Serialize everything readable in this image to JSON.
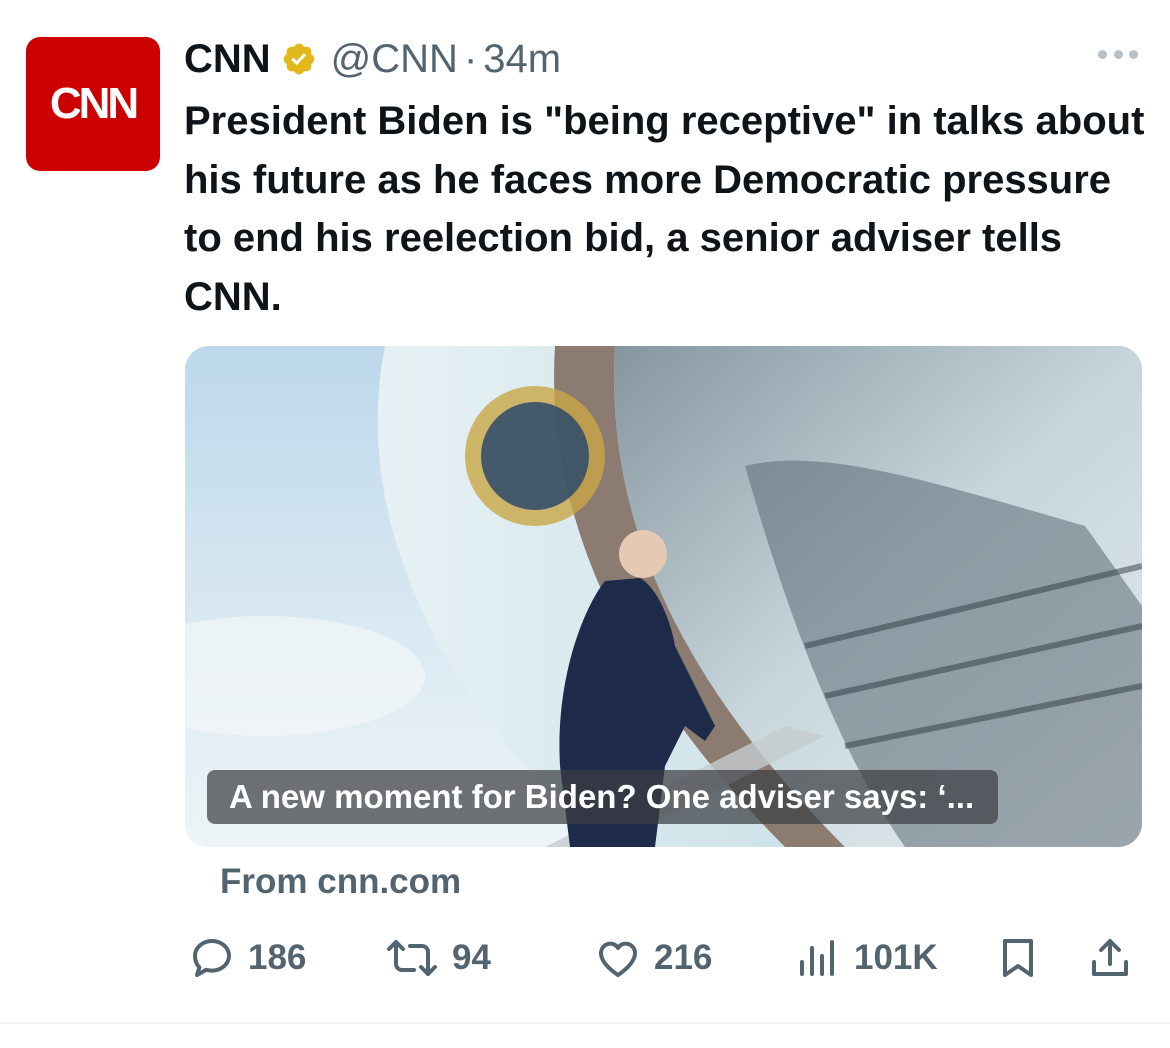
{
  "author": {
    "avatar_text": "CNN",
    "display_name": "CNN",
    "handle": "@CNN",
    "separator": "·",
    "time": "34m",
    "verified_badge": "gold-check-icon"
  },
  "tweet": {
    "text": "President Biden is \"being receptive\" in talks about his future as he faces more Democratic pressure to end his reelection bid, a senior adviser tells CNN."
  },
  "card": {
    "title": "A new moment for Biden? One adviser says: ‘...",
    "source": "From cnn.com"
  },
  "actions": {
    "replies": "186",
    "retweets": "94",
    "likes": "216",
    "views": "101K"
  },
  "colors": {
    "brand_red": "#cc0000",
    "verified_gold": "#e2b719",
    "secondary_text": "#536471",
    "primary_text": "#0f1419"
  }
}
